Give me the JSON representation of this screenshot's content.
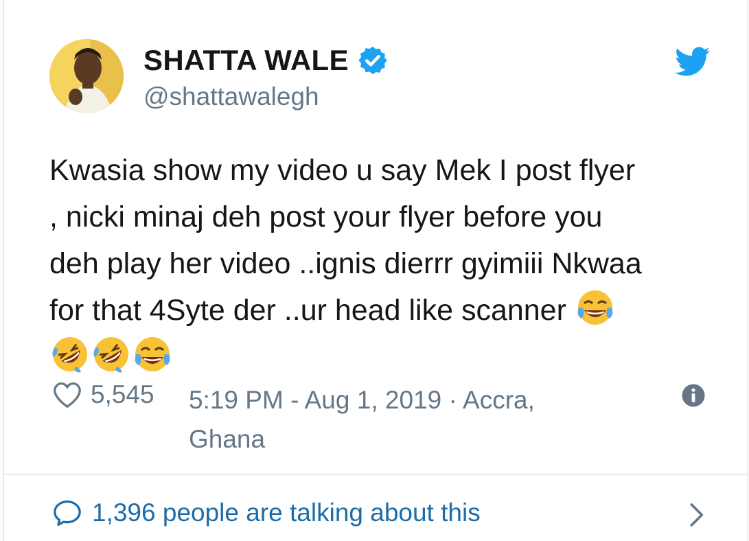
{
  "user": {
    "display_name": "SHATTA WALE",
    "handle": "@shattawalegh",
    "verified": true
  },
  "tweet": {
    "lines": [
      "Kwasia show my video u say Mek I post flyer",
      ", nicki minaj deh post your flyer before you",
      "deh play her video ..ignis dierrr gyimiii Nkwaa",
      "for that 4Syte der ..ur head like scanner"
    ],
    "emojis": [
      "face-with-tears-of-joy",
      "rolling-on-the-floor-laughing",
      "rolling-on-the-floor-laughing",
      "face-with-tears-of-joy"
    ]
  },
  "meta": {
    "likes": "5,545",
    "timestamp": "5:19 PM - Aug 1, 2019 · Accra, Ghana"
  },
  "footer": {
    "talking": "1,396 people are talking about this"
  },
  "colors": {
    "twitter_blue": "#1da1f2",
    "secondary_text": "#657786",
    "link_text": "#1b6ca8",
    "divider": "#e6ecf0"
  }
}
